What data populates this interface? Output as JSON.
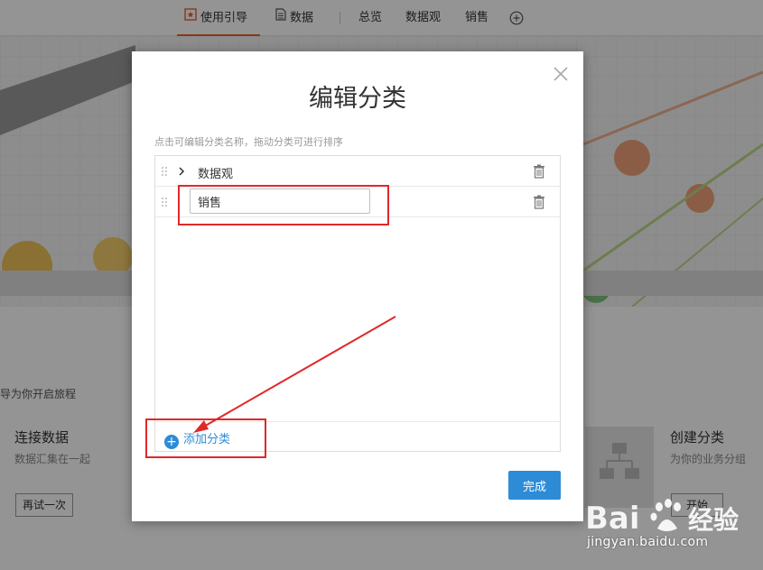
{
  "topnav": {
    "items": [
      {
        "label": "使用引导",
        "active": true
      },
      {
        "label": "数据",
        "active": false
      },
      {
        "label": "总览",
        "active": false
      },
      {
        "label": "数据观",
        "active": false
      },
      {
        "label": "销售",
        "active": false
      }
    ],
    "add_icon": "plus-circle-icon"
  },
  "background": {
    "intro": "导为你开启旅程",
    "card_left": {
      "title": "连接数据",
      "subtitle": "数据汇集在一起",
      "button": "再试一次"
    },
    "card_right": {
      "title": "创建分类",
      "subtitle": "为你的业务分组",
      "button": "开始"
    }
  },
  "modal": {
    "title": "编辑分类",
    "hint": "点击可编辑分类名称，拖动分类可进行排序",
    "categories": [
      {
        "label": "数据观",
        "editing": false
      },
      {
        "label": "销售",
        "editing": true
      }
    ],
    "add_label": "添加分类",
    "done_label": "完成"
  },
  "watermark": {
    "url": "jingyan.baidu.com"
  },
  "colors": {
    "accent": "#2e8bd6",
    "nav_active": "#e8632f",
    "annotation": "#e0282a"
  }
}
